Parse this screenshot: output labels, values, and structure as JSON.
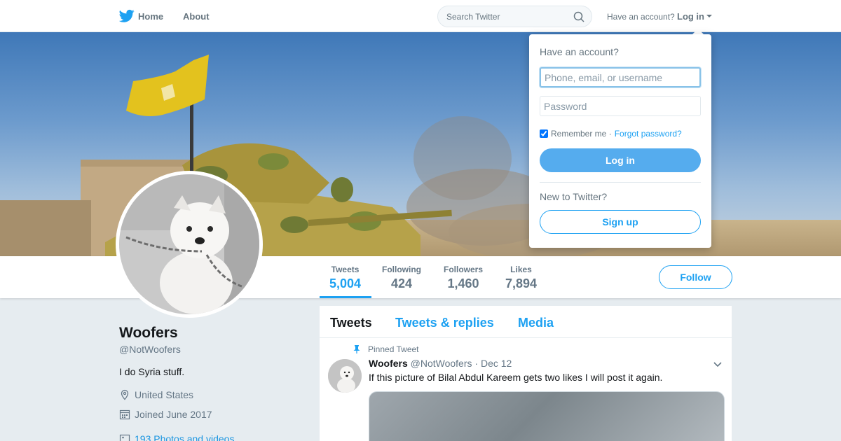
{
  "topbar": {
    "brand_icon": "twitter-bird-icon",
    "nav": [
      {
        "label": "Home",
        "icon": "twitter-bird-icon"
      },
      {
        "label": "About"
      }
    ],
    "search_placeholder": "Search Twitter",
    "have_account": "Have an account?",
    "login_label": "Log in"
  },
  "profile": {
    "name": "Woofers",
    "handle": "@NotWoofers",
    "bio": "I do Syria stuff.",
    "location": "United States",
    "joined": "Joined June 2017",
    "media_link": "193 Photos and videos"
  },
  "stats": [
    {
      "label": "Tweets",
      "value": "5,004"
    },
    {
      "label": "Following",
      "value": "424"
    },
    {
      "label": "Followers",
      "value": "1,460"
    },
    {
      "label": "Likes",
      "value": "7,894"
    }
  ],
  "follow_label": "Follow",
  "timeline": {
    "tabs": [
      "Tweets",
      "Tweets & replies",
      "Media"
    ],
    "pinned_label": "Pinned Tweet",
    "tweet": {
      "name": "Woofers",
      "handle": "@NotWoofers",
      "date": "· Dec 12",
      "text": "If this picture of Bilal Abdul Kareem gets two likes I will post it again."
    }
  },
  "login_dropdown": {
    "title": "Have an account?",
    "username_placeholder": "Phone, email, or username",
    "password_placeholder": "Password",
    "remember_label": "Remember me ·",
    "forgot_label": "Forgot password?",
    "login_button": "Log in",
    "new_label": "New to Twitter?",
    "signup_button": "Sign up"
  },
  "colors": {
    "accent": "#1da1f2",
    "login_button": "#55acee"
  }
}
